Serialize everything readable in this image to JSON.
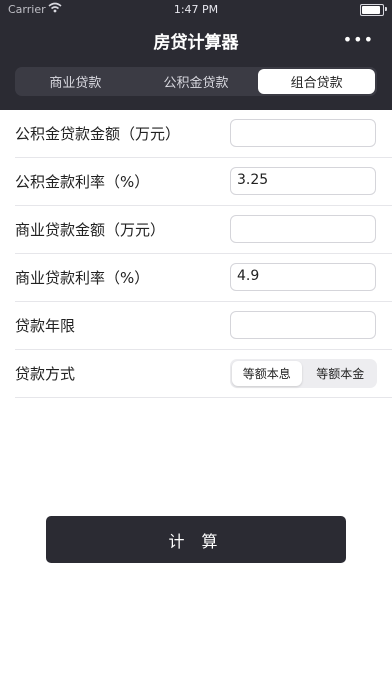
{
  "status_bar": {
    "carrier": "Carrier",
    "time": "1:47 PM"
  },
  "header": {
    "title": "房贷计算器",
    "more": "•••"
  },
  "tabs": [
    {
      "label": "商业贷款",
      "selected": false
    },
    {
      "label": "公积金贷款",
      "selected": false
    },
    {
      "label": "组合贷款",
      "selected": true
    }
  ],
  "form": {
    "fund_amount_label": "公积金贷款金额（万元）",
    "fund_amount_value": "",
    "fund_rate_label": "公积金款利率（%）",
    "fund_rate_value": "3.25",
    "commercial_amount_label": "商业贷款金额（万元）",
    "commercial_amount_value": "",
    "commercial_rate_label": "商业贷款利率（%）",
    "commercial_rate_value": "4.9",
    "years_label": "贷款年限",
    "years_value": "",
    "method_label": "贷款方式",
    "method_options": [
      {
        "label": "等额本息",
        "selected": true
      },
      {
        "label": "等额本金",
        "selected": false
      }
    ]
  },
  "calculate_button": "计 算",
  "colors": {
    "header_bg": "#2b2b33",
    "button_bg": "#2b2b33"
  }
}
